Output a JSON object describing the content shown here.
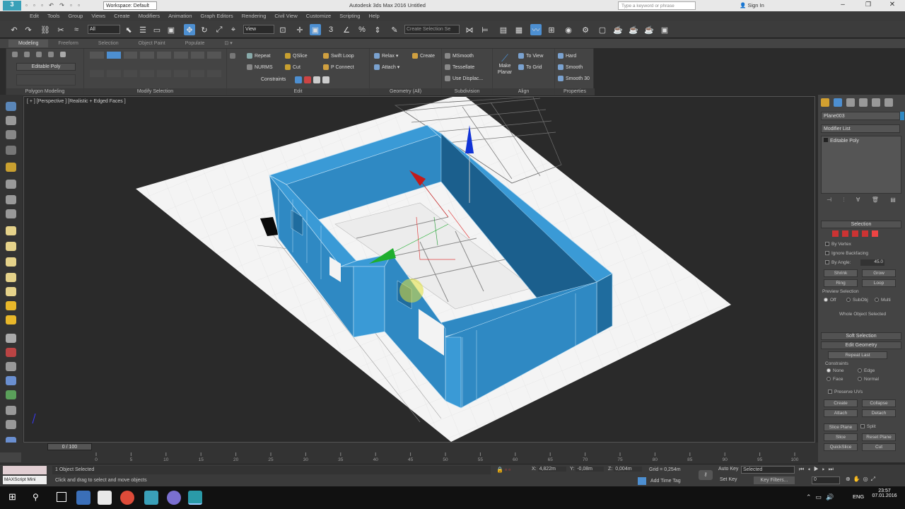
{
  "window": {
    "workspace_label": "Workspace: Default",
    "title": "Autodesk 3ds Max 2016    Untitled",
    "search_placeholder": "Type a keyword or phrase",
    "sign_in": "Sign In"
  },
  "menu": [
    "Edit",
    "Tools",
    "Group",
    "Views",
    "Create",
    "Modifiers",
    "Animation",
    "Graph Editors",
    "Rendering",
    "Civil View",
    "Customize",
    "Scripting",
    "Help"
  ],
  "toolbar": {
    "selection_filter": "All",
    "ref_coord": "View",
    "named_selection": "Create Selection Se"
  },
  "ribbon": {
    "tabs": [
      "Modeling",
      "Freeform",
      "Selection",
      "Object Paint",
      "Populate"
    ],
    "active_tab": "Modeling",
    "edit_poly_label": "Editable Poly",
    "sections": [
      "Polygon Modeling",
      "Modify Selection",
      "Edit",
      "Geometry (All)",
      "Subdivision",
      "Align",
      "Properties"
    ],
    "edit": {
      "repeat": "Repeat",
      "qslice": "QSlice",
      "swiftloop": "Swift Loop",
      "nurms": "NURMS",
      "cut": "Cut",
      "pconnect": "P Connect",
      "constraints": "Constraints"
    },
    "geometry": {
      "relax": "Relax",
      "create": "Create",
      "attach": "Attach"
    },
    "subdivision": {
      "msmooth": "MSmooth",
      "tessellate": "Tessellate",
      "use_displace": "Use Displac..."
    },
    "align": {
      "make_planar": "Make Planar",
      "to_view": "To View",
      "to_grid": "To Grid"
    },
    "properties": {
      "hard": "Hard",
      "smooth": "Smooth",
      "smooth30": "Smooth 30"
    }
  },
  "viewport": {
    "label": "[ + ] [Perspective ] [Realistic + Edged Faces ]"
  },
  "command_panel": {
    "object_name": "Plane003",
    "modifier_list": "Modifier List",
    "stack_item": "Editable Poly",
    "rollouts": {
      "selection": "Selection",
      "by_vertex": "By Vertex",
      "ignore_backfacing": "Ignore Backfacing",
      "by_angle": "By Angle:",
      "angle_value": "45.0",
      "shrink": "Shrink",
      "grow": "Grow",
      "ring": "Ring",
      "loop": "Loop",
      "preview_selection": "Preview Selection",
      "off": "Off",
      "subobj": "SubObj",
      "multi": "Multi",
      "whole_object": "Whole Object Selected",
      "soft_selection": "Soft Selection",
      "edit_geometry": "Edit Geometry",
      "repeat_last": "Repeat Last",
      "constraints": "Constraints",
      "none": "None",
      "edge": "Edge",
      "face": "Face",
      "normal": "Normal",
      "preserve_uvs": "Preserve UVs",
      "create": "Create",
      "collapse": "Collapse",
      "attach": "Attach",
      "detach": "Detach",
      "slice_plane": "Slice Plane",
      "split": "Split",
      "slice": "Slice",
      "reset_plane": "Reset Plane",
      "quickslice": "QuickSlice",
      "cut": "Cut"
    }
  },
  "timeline": {
    "slider": "0 / 100",
    "ticks": [
      "0",
      "5",
      "10",
      "15",
      "20",
      "25",
      "30",
      "35",
      "40",
      "45",
      "50",
      "55",
      "60",
      "65",
      "70",
      "75",
      "80",
      "85",
      "90",
      "95",
      "100"
    ]
  },
  "status": {
    "script_listener": "MAXScript Mini",
    "objects_selected": "1 Object Selected",
    "prompt": "Click and drag to select and move objects",
    "x_label": "X:",
    "x_value": "4,822m",
    "y_label": "Y:",
    "y_value": "-0,08m",
    "z_label": "Z:",
    "z_value": "0,004m",
    "grid": "Grid = 0,254m",
    "add_time_tag": "Add Time Tag",
    "auto_key": "Auto Key",
    "selected": "Selected",
    "set_key": "Set Key",
    "key_filters": "Key Filters...",
    "frame": "0"
  },
  "taskbar": {
    "lang": "ENG",
    "time": "23:57",
    "date": "07.01.2016"
  },
  "colors": {
    "wall": "#2f89c3",
    "wall_top": "#3a9ad6",
    "wall_dark": "#1f6c9e",
    "viewport_bg": "#2a2a2a",
    "gizmo_x": "#c21b1b",
    "gizmo_y": "#1fae2e",
    "gizmo_z": "#1133d6"
  }
}
